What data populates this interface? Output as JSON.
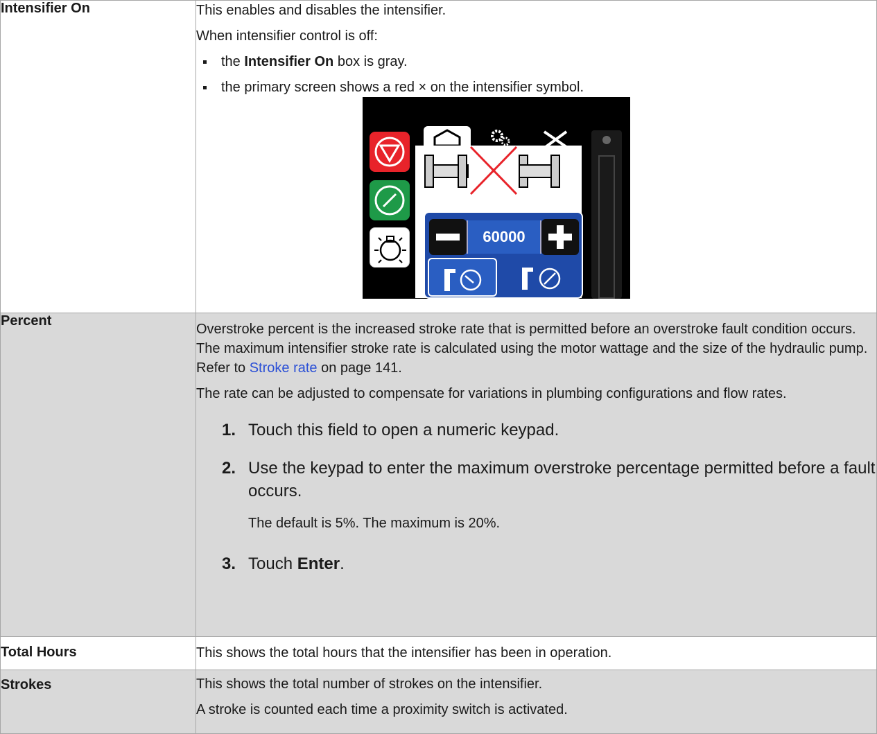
{
  "rows": [
    {
      "label": "Intensifier On",
      "intro": "This enables and disables the intensifier.",
      "control_off": "When intensifier control is off:",
      "bullet1": {
        "pre": "the ",
        "bold": "Intensifier On",
        "post": " box is gray."
      },
      "bullet2": "the primary screen shows a red × on the intensifier symbol.",
      "hmi": {
        "pressure_value": "60000",
        "minus": "−",
        "plus": "+"
      }
    },
    {
      "label": "Percent",
      "para1_pre": "Overstroke percent is the increased stroke rate that is permitted before an overstroke fault condition occurs. The maximum intensifier stroke rate is calculated using the motor wattage and the size of the hydraulic pump. Refer to ",
      "link": "Stroke rate",
      "para1_post": " on page 141.",
      "para2": "The rate can be adjusted to compensate for variations in plumbing configurations and flow rates.",
      "steps": [
        {
          "num": "1.",
          "text": "Touch this field to open a numeric keypad."
        },
        {
          "num": "2.",
          "text": "Use the keypad to enter the maximum overstroke percentage permitted before a fault occurs.",
          "note": "The default is 5%. The maximum is 20%."
        },
        {
          "num": "3.",
          "pre": "Touch ",
          "bold": "Enter",
          "post": "."
        }
      ]
    },
    {
      "label": "Total Hours",
      "text": "This shows the total hours that the intensifier has been in operation."
    },
    {
      "label": "Strokes",
      "text1": "This shows the total number of strokes on the intensifier.",
      "text2": "A stroke is counted each time a proximity switch is activated."
    }
  ],
  "colors": {
    "row_gray": "#d9d9d9",
    "border": "#a6a6a6",
    "link": "#2a4fd6",
    "hmi_red": "#e8232a",
    "hmi_green": "#1e9a48",
    "hmi_blue": "#1f4aa8"
  }
}
